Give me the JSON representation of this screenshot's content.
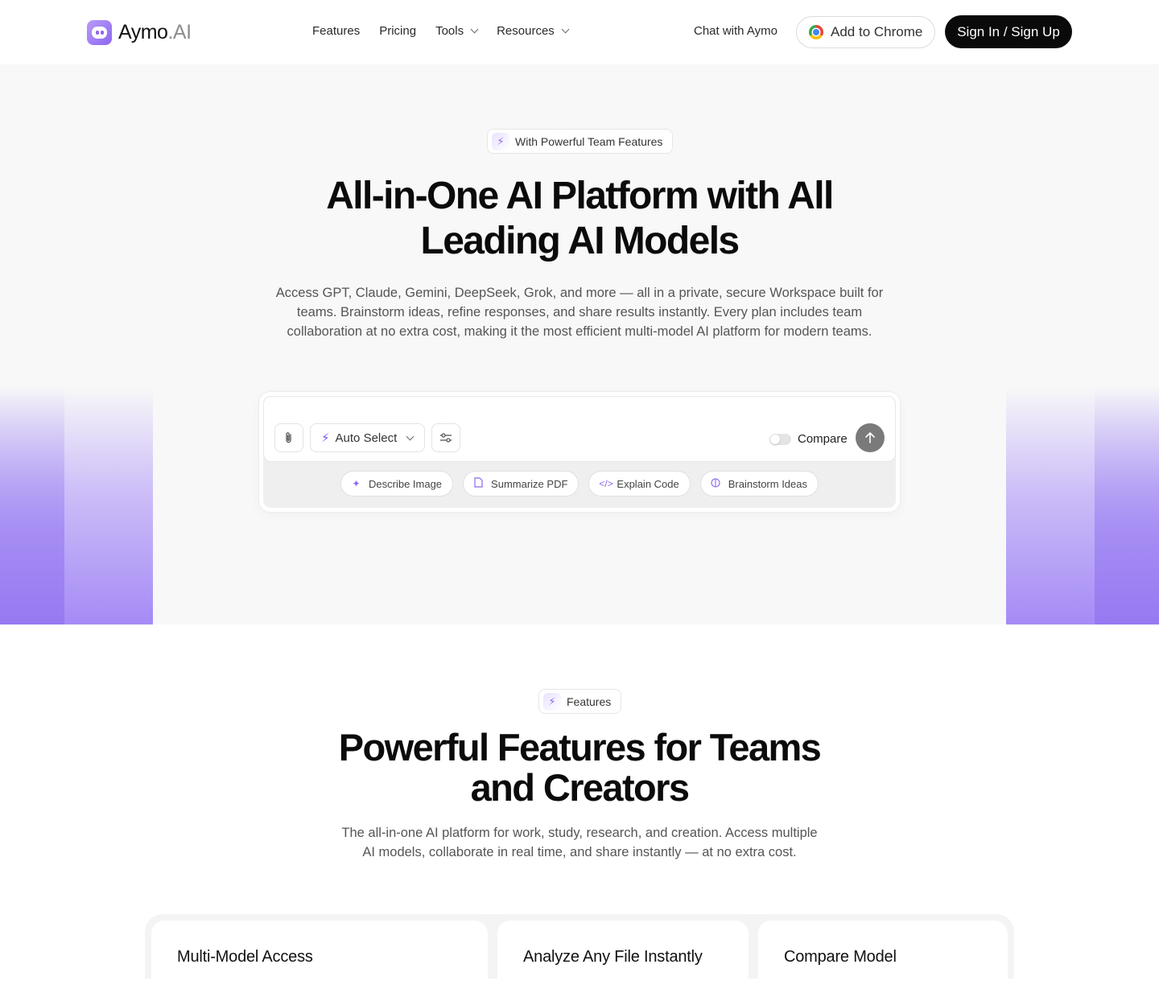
{
  "nav": {
    "logo_main": "Aymo",
    "logo_suffix": ".AI",
    "links": [
      {
        "label": "Features"
      },
      {
        "label": "Pricing"
      },
      {
        "label": "Tools"
      },
      {
        "label": "Resources"
      }
    ],
    "chat_link": "Chat with Aymo",
    "chrome_button": "Add to Chrome",
    "signin_button": "Sign In / Sign Up"
  },
  "hero": {
    "badge": "With Powerful Team Features",
    "title_line1": "All-in-One AI Platform with All",
    "title_line2": "Leading AI Models",
    "subtitle": "Access GPT, Claude, Gemini, DeepSeek, Grok, and more — all in a private, secure Workspace built for teams. Brainstorm ideas, refine responses, and share results instantly. Every plan includes team collaboration at no extra cost, making it the most efficient multi-model AI platform for modern teams."
  },
  "chat": {
    "model_select": "Auto Select",
    "compare_label": "Compare",
    "suggestions": [
      {
        "label": "Describe Image",
        "icon": "sparkle-icon"
      },
      {
        "label": "Summarize PDF",
        "icon": "document-icon"
      },
      {
        "label": "Explain Code",
        "icon": "code-icon"
      },
      {
        "label": "Brainstorm Ideas",
        "icon": "brain-icon"
      }
    ]
  },
  "features": {
    "badge": "Features",
    "title_line1": "Powerful Features for Teams",
    "title_line2": "and Creators",
    "subtitle": "The all-in-one AI platform for work, study, research, and creation. Access multiple AI models, collaborate in real time, and share instantly — at no extra cost.",
    "cards": [
      {
        "title": "Multi-Model Access"
      },
      {
        "title": "Analyze Any File Instantly"
      },
      {
        "title": "Compare Model"
      }
    ]
  },
  "colors": {
    "accent": "#8d66f0",
    "primary_button": "#0a0a0a",
    "hero_background": "#f8f8f8"
  }
}
